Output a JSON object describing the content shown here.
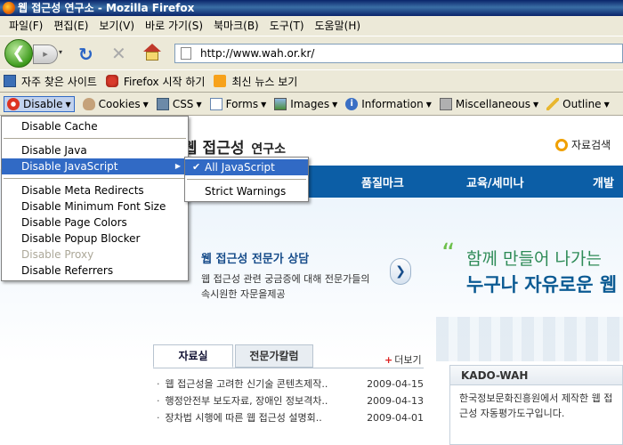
{
  "window": {
    "title": "웹 접근성 연구소 - Mozilla Firefox"
  },
  "menubar": {
    "items": [
      "파일(F)",
      "편집(E)",
      "보기(V)",
      "바로 가기(S)",
      "북마크(B)",
      "도구(T)",
      "도움말(H)"
    ]
  },
  "nav": {
    "url": "http://www.wah.or.kr/",
    "back_glyph": "❮",
    "fwd_glyph": "▸",
    "hist_glyph": "▾",
    "reload_glyph": "↻",
    "stop_glyph": "✕"
  },
  "bookmarks": {
    "items": [
      "자주 찾은 사이트",
      "Firefox 시작 하기",
      "최신 뉴스 보기"
    ]
  },
  "webdev": {
    "items": [
      "Disable",
      "Cookies",
      "CSS",
      "Forms",
      "Images",
      "Information",
      "Miscellaneous",
      "Outline"
    ],
    "arrow": "▼"
  },
  "disable_menu": {
    "items": [
      "Disable Cache",
      "Disable Java",
      "Disable JavaScript",
      "Disable Meta Redirects",
      "Disable Minimum Font Size",
      "Disable Page Colors",
      "Disable Popup Blocker",
      "Disable Proxy",
      "Disable Referrers"
    ],
    "submenu_arrow": "▶"
  },
  "js_submenu": {
    "items": [
      "All JavaScript",
      "Strict Warnings"
    ],
    "check": "✔"
  },
  "page": {
    "logo": "웹 접근성",
    "logo_sub": "연구소",
    "search_label": "자료검색",
    "gnb": [
      "품질마크",
      "교육/세미나",
      "개발"
    ],
    "consult_title": "웹 접근성 전문가 상담",
    "consult_desc": "웹 접근성 관련 궁금증에 대해 전문가들의 속시원한 자문을제공",
    "next_glyph": "❯",
    "slogan_quote": "“",
    "slogan1": "함께 만들어 나가는",
    "slogan2": "누구나 자유로운 웹",
    "tabs": [
      "자료실",
      "전문가칼럼"
    ],
    "more_plus": "+",
    "more": "더보기",
    "news": [
      {
        "title": "웹 접근성을 고려한 신기술 콘텐츠제작..",
        "date": "2009-04-15"
      },
      {
        "title": "행정안전부 보도자료, 장애인 정보격차..",
        "date": "2009-04-13"
      },
      {
        "title": "장차법 시행에 따른 웹 접근성 설명회..",
        "date": "2009-04-01"
      }
    ],
    "kado_title": "KADO-WAH",
    "kado_desc": "한국정보문화진흥원에서 제작한 웹 접근성 자동평가도구입니다."
  },
  "colors": {
    "gnb": "#0c5ea6",
    "highlight": "#316ac5",
    "slogan_green": "#2e8b57",
    "slogan_blue": "#0b5a93"
  }
}
